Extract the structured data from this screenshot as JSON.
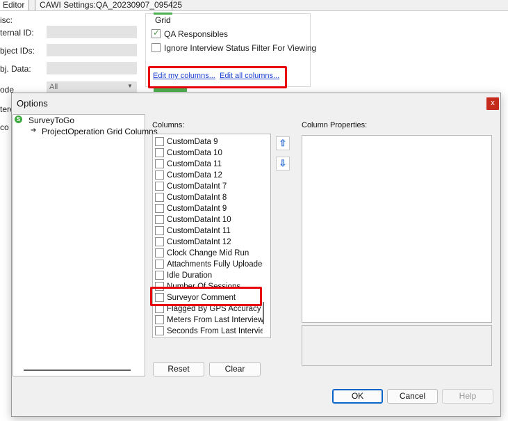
{
  "background": {
    "tabs": [
      "Editor",
      "CAWI Settings:QA_20230907_095425"
    ],
    "labels": {
      "misc": "isc:",
      "internal_id": "ternal ID:",
      "object_ids": "bject IDs:",
      "obj_data": "bj. Data:",
      "mode": "ode",
      "partial1": "tere",
      "partial2": "co"
    },
    "mode_value": "All",
    "grid": {
      "title": "Grid",
      "qa_responsibles": "QA Responsibles",
      "ignore_filter": "Ignore Interview Status Filter For Viewing",
      "edit_my_columns": "Edit my columns...",
      "edit_all_columns": "Edit all columns..."
    }
  },
  "dialog": {
    "title": "Options",
    "close": "x",
    "tree": {
      "root": "SurveyToGo",
      "child": "ProjectOperation Grid Columns"
    },
    "columns_label": "Columns:",
    "column_properties_label": "Column Properties:",
    "columns": [
      "CustomData 9",
      "CustomData 10",
      "CustomData 11",
      "CustomData 12",
      "CustomDataInt 7",
      "CustomDataInt 8",
      "CustomDataInt 9",
      "CustomDataInt 10",
      "CustomDataInt 11",
      "CustomDataInt 12",
      "Clock Change Mid Run",
      "Attachments Fully Uploaded",
      "Idle Duration",
      "Number Of Sessions",
      "Surveyor Comment",
      "Flagged By GPS Accuracy",
      "Meters From Last Interview",
      "Seconds From Last Interview"
    ],
    "buttons": {
      "reset": "Reset",
      "clear": "Clear",
      "ok": "OK",
      "cancel": "Cancel",
      "help": "Help"
    }
  },
  "colors": {
    "highlight": "#e8000b",
    "accent_green": "#4caf50",
    "link": "#1a3fcf",
    "close_red": "#c42b1c"
  }
}
